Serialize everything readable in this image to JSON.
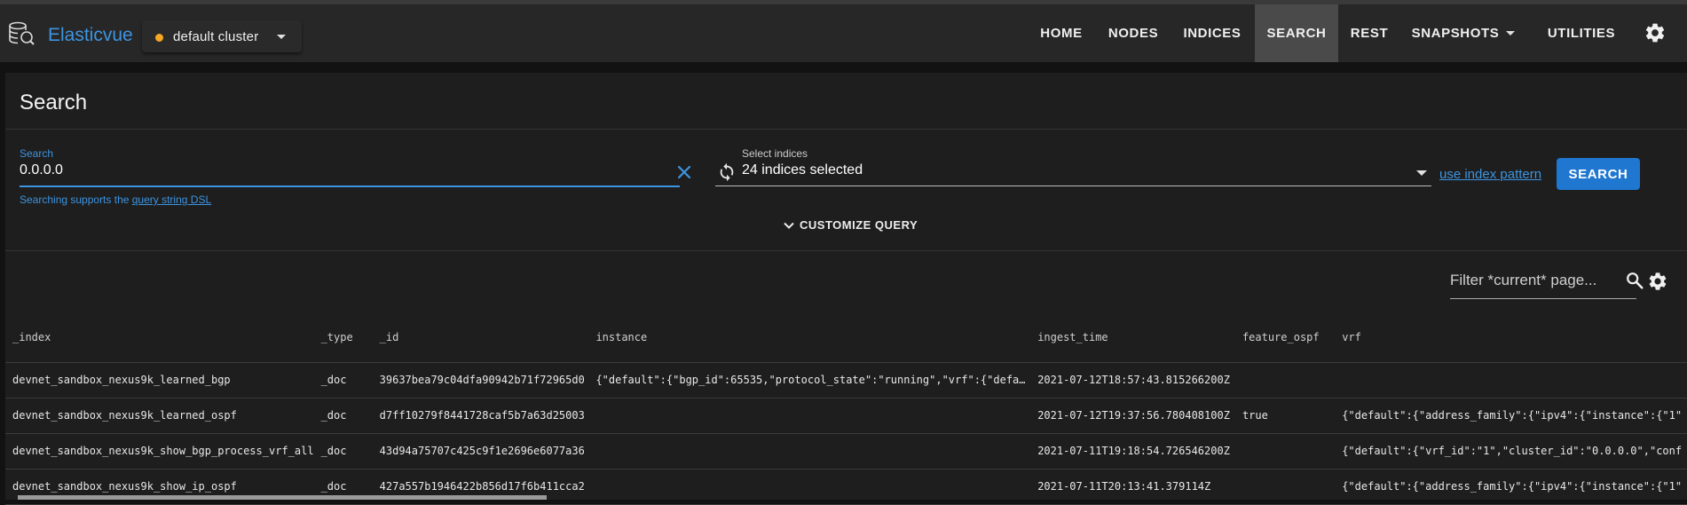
{
  "app": {
    "name": "Elasticvue",
    "cluster_name": "default cluster",
    "cluster_status_color": "#f5a623",
    "accent_color": "#3d94e0"
  },
  "nav": {
    "items": [
      "HOME",
      "NODES",
      "INDICES",
      "SEARCH",
      "REST",
      "SNAPSHOTS",
      "UTILITIES"
    ],
    "active": "SEARCH"
  },
  "page": {
    "title": "Search"
  },
  "search": {
    "label": "Search",
    "value": "0.0.0.0",
    "hint_prefix": "Searching supports the ",
    "hint_link": "query string DSL",
    "indices_label": "Select indices",
    "indices_value": "24 indices selected",
    "use_index_pattern": "use index pattern",
    "button": "SEARCH",
    "customize": "CUSTOMIZE QUERY"
  },
  "filter": {
    "placeholder": "Filter *current* page..."
  },
  "table": {
    "columns": [
      "_index",
      "_type",
      "_id",
      "instance",
      "ingest_time",
      "feature_ospf",
      "vrf"
    ],
    "rows": [
      [
        "devnet_sandbox_nexus9k_learned_bgp",
        "_doc",
        "39637bea79c04dfa90942b71f72965d0",
        "{\"default\":{\"bgp_id\":65535,\"protocol_state\":\"running\",\"vrf\":{\"defa…",
        "2021-07-12T18:57:43.815266200Z",
        "",
        ""
      ],
      [
        "devnet_sandbox_nexus9k_learned_ospf",
        "_doc",
        "d7ff10279f8441728caf5b7a63d25003",
        "",
        "2021-07-12T19:37:56.780408100Z",
        "true",
        "{\"default\":{\"address_family\":{\"ipv4\":{\"instance\":{\"1\""
      ],
      [
        "devnet_sandbox_nexus9k_show_bgp_process_vrf_all",
        "_doc",
        "43d94a75707c425c9f1e2696e6077a36",
        "",
        "2021-07-11T19:18:54.726546200Z",
        "",
        "{\"default\":{\"vrf_id\":\"1\",\"cluster_id\":\"0.0.0.0\",\"conf"
      ],
      [
        "devnet_sandbox_nexus9k_show_ip_ospf",
        "_doc",
        "427a557b1946422b856d17f6b411cca2",
        "",
        "2021-07-11T20:13:41.379114Z",
        "",
        "{\"default\":{\"address_family\":{\"ipv4\":{\"instance\":{\"1\""
      ]
    ]
  }
}
